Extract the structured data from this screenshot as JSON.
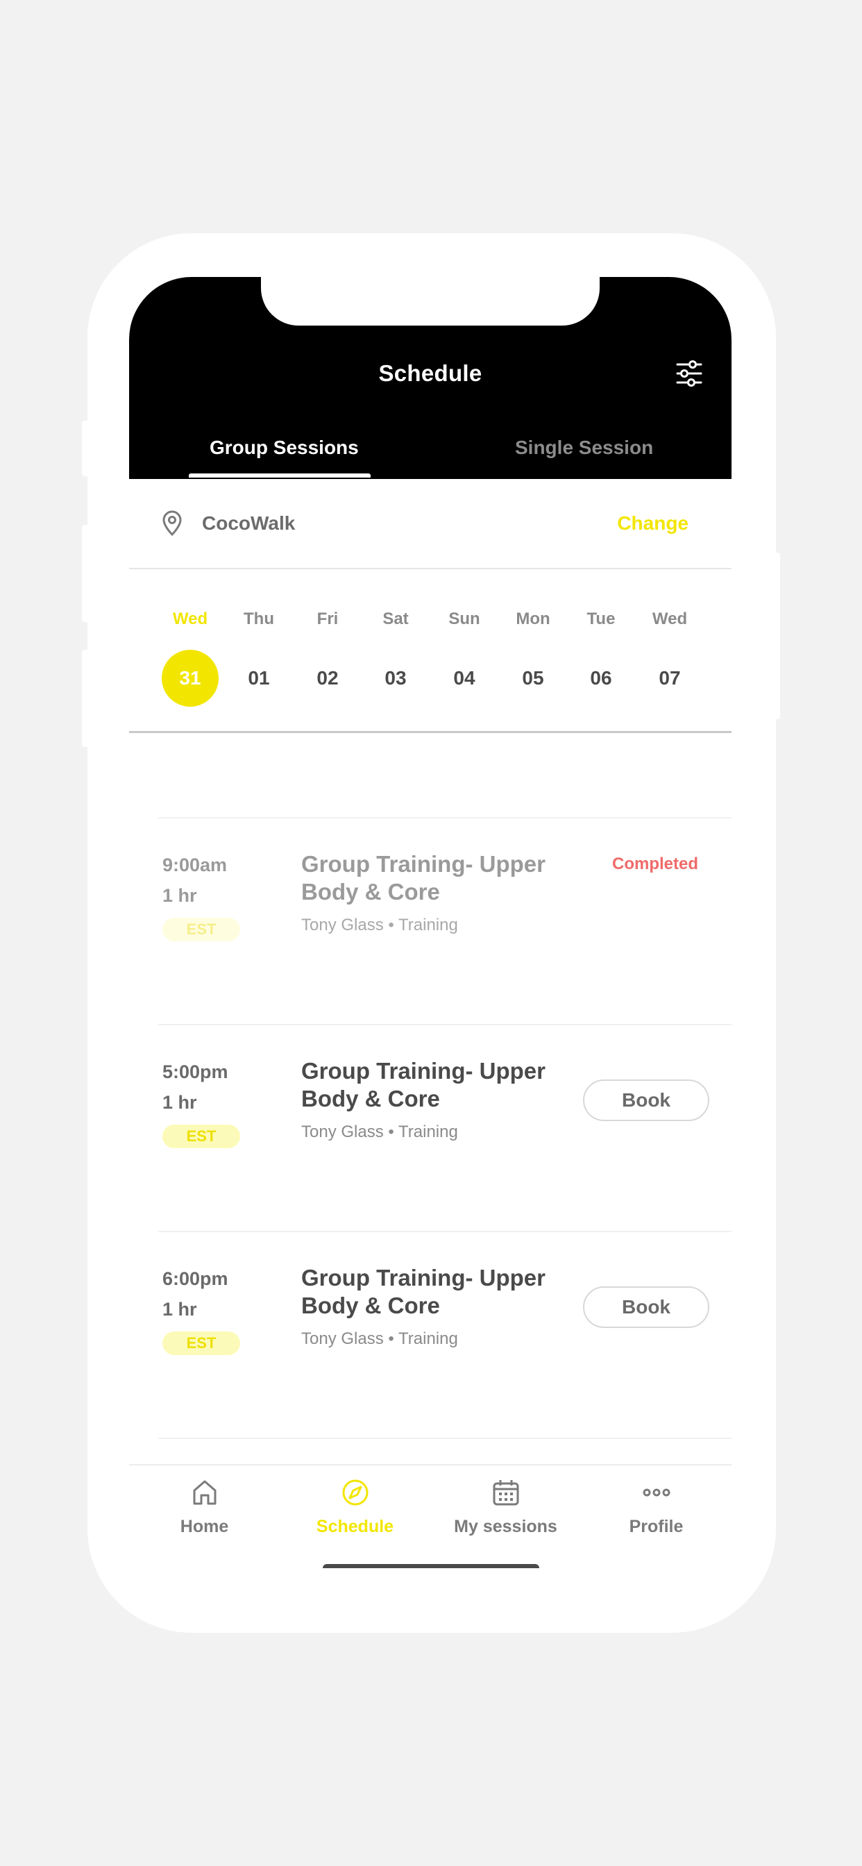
{
  "header": {
    "title": "Schedule",
    "filter_icon": "sliders-icon",
    "tabs": [
      {
        "label": "Group Sessions",
        "active": true
      },
      {
        "label": "Single Session",
        "active": false
      }
    ]
  },
  "location": {
    "icon": "map-pin-icon",
    "name": "CocoWalk",
    "change_label": "Change"
  },
  "calendar": {
    "days": [
      {
        "name": "Wed",
        "num": "31",
        "selected": true
      },
      {
        "name": "Thu",
        "num": "01"
      },
      {
        "name": "Fri",
        "num": "02"
      },
      {
        "name": "Sat",
        "num": "03"
      },
      {
        "name": "Sun",
        "num": "04"
      },
      {
        "name": "Mon",
        "num": "05"
      },
      {
        "name": "Tue",
        "num": "06"
      },
      {
        "name": "Wed",
        "num": "07"
      }
    ]
  },
  "sessions": [
    {
      "time": "9:00am",
      "duration": "1 hr",
      "timezone": "EST",
      "title": "Group Training- Upper Body & Core",
      "meta": "Tony Glass • Training",
      "status": "Completed"
    },
    {
      "time": "5:00pm",
      "duration": "1 hr",
      "timezone": "EST",
      "title": "Group Training- Upper Body & Core",
      "meta": "Tony Glass • Training",
      "action": "Book"
    },
    {
      "time": "6:00pm",
      "duration": "1 hr",
      "timezone": "EST",
      "title": "Group Training- Upper Body & Core",
      "meta": "Tony Glass • Training",
      "action": "Book"
    }
  ],
  "tabbar": [
    {
      "label": "Home",
      "icon": "home-icon"
    },
    {
      "label": "Schedule",
      "icon": "compass-icon",
      "active": true
    },
    {
      "label": "My sessions",
      "icon": "calendar-icon"
    },
    {
      "label": "Profile",
      "icon": "more-icon"
    }
  ],
  "colors": {
    "accent": "#f2e600",
    "header_bg": "#000000",
    "completed": "#f06a6a"
  }
}
